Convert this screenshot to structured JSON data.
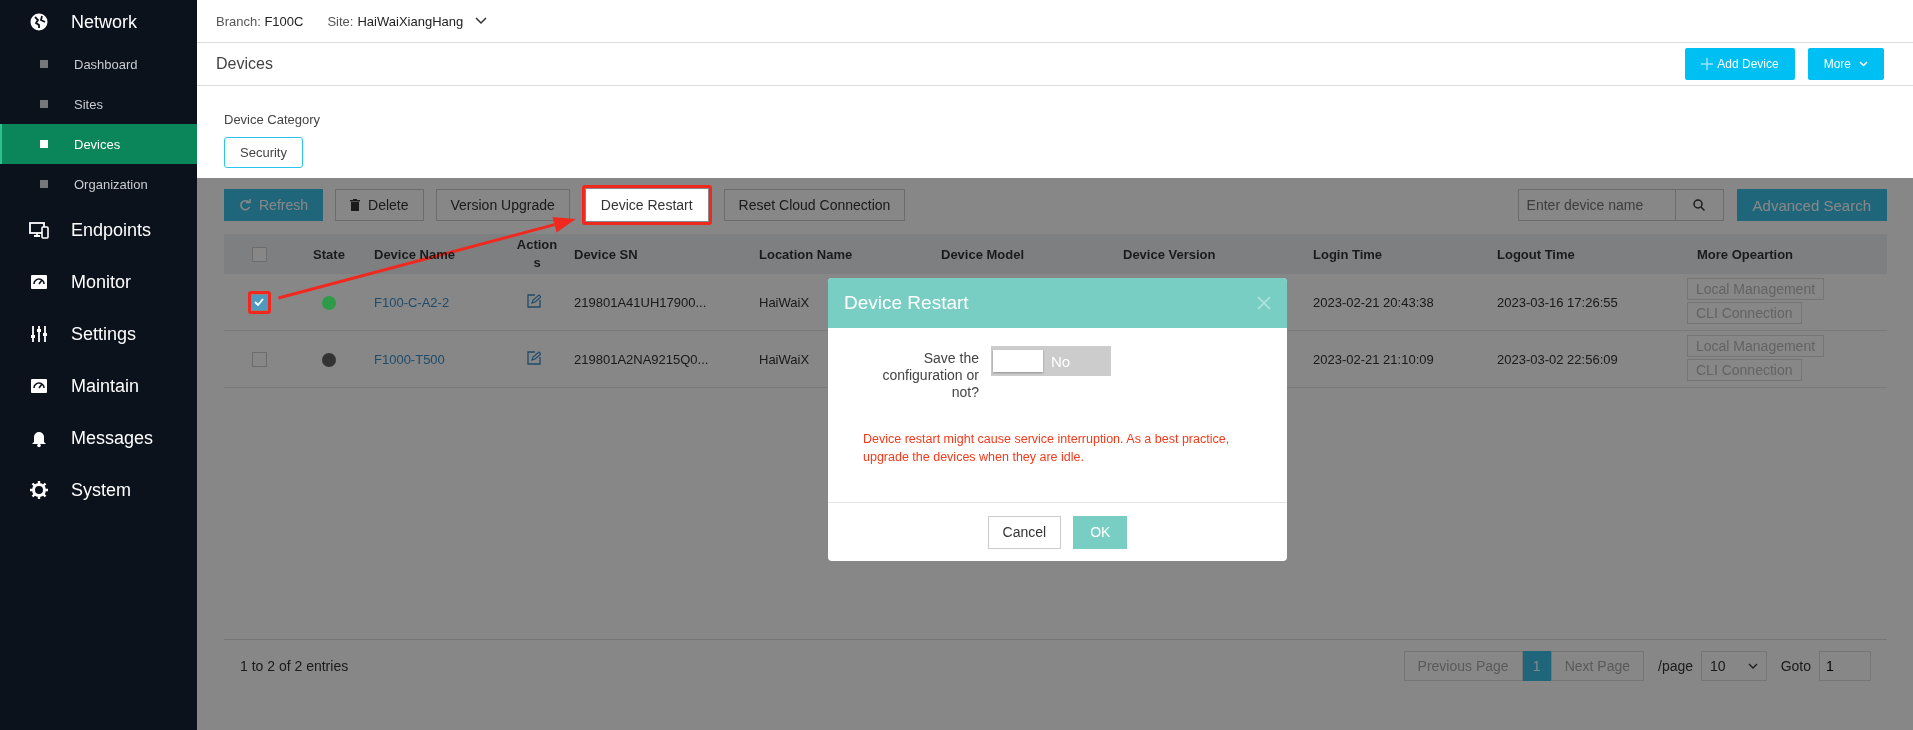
{
  "sidebar": {
    "items": [
      {
        "kind": "section",
        "label": "Network",
        "children": [
          {
            "label": "Dashboard",
            "selected": false
          },
          {
            "label": "Sites",
            "selected": false
          },
          {
            "label": "Devices",
            "selected": true
          },
          {
            "label": "Organization",
            "selected": false
          }
        ]
      },
      {
        "kind": "section",
        "label": "Endpoints"
      },
      {
        "kind": "section",
        "label": "Monitor"
      },
      {
        "kind": "section",
        "label": "Settings"
      },
      {
        "kind": "section",
        "label": "Maintain"
      },
      {
        "kind": "section",
        "label": "Messages"
      },
      {
        "kind": "section",
        "label": "System"
      }
    ]
  },
  "topbar": {
    "branch_label": "Branch:",
    "branch": "F100C",
    "site_label": "Site:",
    "site": "HaiWaiXiangHang"
  },
  "page_header": {
    "title": "Devices",
    "buttons": [
      {
        "kind": "add",
        "label": "Add Device"
      },
      {
        "kind": "menu",
        "label": "More"
      }
    ]
  },
  "category": {
    "label": "Device Category",
    "tabs": [
      {
        "label": "Security",
        "selected": true
      }
    ]
  },
  "toolbar": {
    "buttons": [
      {
        "kind": "refresh",
        "label": "Refresh",
        "highlighted": false
      },
      {
        "kind": "delete",
        "label": "Delete",
        "highlighted": false
      },
      {
        "kind": "plain",
        "label": "Version Upgrade",
        "highlighted": false
      },
      {
        "kind": "plain",
        "label": "Device Restart",
        "highlighted": true
      },
      {
        "kind": "plain",
        "label": "Reset Cloud Connection",
        "highlighted": false
      }
    ],
    "search": {
      "placeholder": "Enter device name"
    },
    "advanced_search": "Advanced Search"
  },
  "table": {
    "header_checked": false,
    "columns": [
      "State",
      "Device Name",
      "Actions",
      "Device SN",
      "Location Name",
      "Device Model",
      "Device Version",
      "Login Time",
      "Logout Time",
      "More Opeartion"
    ],
    "rows": [
      {
        "selected": true,
        "highlighted": true,
        "color": "#2e9b48",
        "device_name": "F100-C-A2-2",
        "device_sn": "219801A41UH17900...",
        "location": "HaiWaiX",
        "login_time": "2023-02-21 20:43:38",
        "logout_time": "2023-03-16 17:26:55",
        "operations": [
          "Local Management",
          "CLI Connection"
        ]
      },
      {
        "selected": false,
        "highlighted": false,
        "color": "#333333",
        "device_name": "F1000-T500",
        "device_sn": "219801A2NA9215Q0...",
        "location": "HaiWaiX",
        "login_time": "2023-02-21 21:10:09",
        "logout_time": "2023-03-02 22:56:09",
        "operations": [
          "Local Management",
          "CLI Connection"
        ]
      }
    ]
  },
  "pagination": {
    "summary": "1 to 2 of 2 entries",
    "previous": "Previous Page",
    "pages": [
      {
        "label": "1",
        "selected": true
      }
    ],
    "next": "Next Page",
    "per_page_label": "/page",
    "per_page": "10",
    "goto_label": "Goto",
    "goto": "1"
  },
  "dialog": {
    "title": "Device Restart",
    "toggle": {
      "label": "Save the configuration or not?",
      "on": false,
      "state_text": "No"
    },
    "warning": "Device restart might cause service interruption. As a best practice, upgrade the devices when they are idle.",
    "buttons": [
      {
        "kind": "cancel",
        "label": "Cancel"
      },
      {
        "kind": "ok",
        "label": "OK"
      }
    ]
  }
}
